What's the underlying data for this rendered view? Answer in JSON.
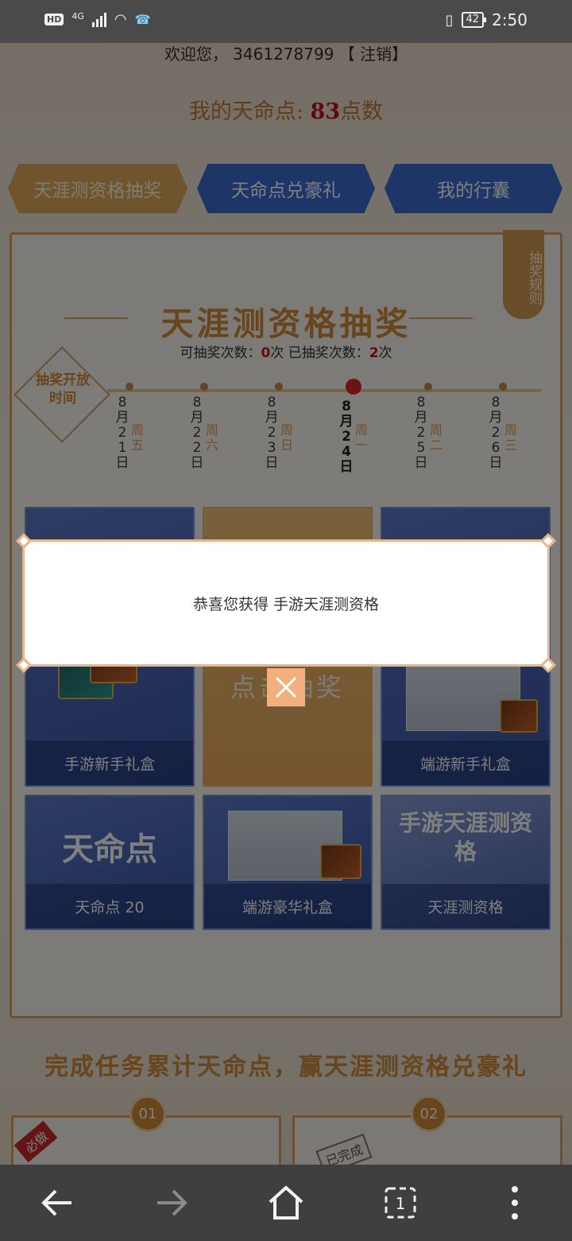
{
  "statusbar": {
    "hd": "HD",
    "network": "4G",
    "battery": "42",
    "time": "2:50"
  },
  "page": {
    "welcome_text": "欢迎您， 3461278799 【 注销】",
    "points_label": "我的天命点: ",
    "points_value": "83",
    "points_unit": "点数",
    "tabs": [
      {
        "label": "天涯测资格抽奖"
      },
      {
        "label": "天命点兑豪礼"
      },
      {
        "label": "我的行囊"
      }
    ],
    "rules_label": "抽奖规则",
    "lottery_title": "天涯测资格抽奖",
    "counts": {
      "available_label": "可抽奖次数：",
      "available_value": "0",
      "used_label": "次 已抽奖次数：",
      "used_value": "2",
      "unit": "次"
    },
    "open_time_label": "抽奖开放时间",
    "schedule": [
      {
        "date": "8月21日",
        "weekday": "周五"
      },
      {
        "date": "8月22日",
        "weekday": "周六"
      },
      {
        "date": "8月23日",
        "weekday": "周日"
      },
      {
        "date": "8月24日",
        "weekday": "周一"
      },
      {
        "date": "8月25日",
        "weekday": "周二"
      },
      {
        "date": "8月26日",
        "weekday": "周三"
      }
    ],
    "prizes": [
      {
        "label": "手游新手礼盒"
      },
      {
        "label": "点击抽奖"
      },
      {
        "label": "端游新手礼盒"
      },
      {
        "label": "天命点 20",
        "art": "天命点"
      },
      {
        "label": "端游豪华礼盒"
      },
      {
        "label": "天涯测资格",
        "art": "手游天涯测资格"
      }
    ],
    "task_title": "完成任务累计天命点，赢天涯测资格兑豪礼",
    "tasks": [
      {
        "num": "01",
        "badge": "必做"
      },
      {
        "num": "02",
        "badge": "已完成"
      }
    ]
  },
  "dialog": {
    "message": "恭喜您获得 手游天涯测资格"
  },
  "colors": {
    "gold": "#d08a38",
    "blue": "#3b6bcf",
    "red": "#c01818"
  }
}
